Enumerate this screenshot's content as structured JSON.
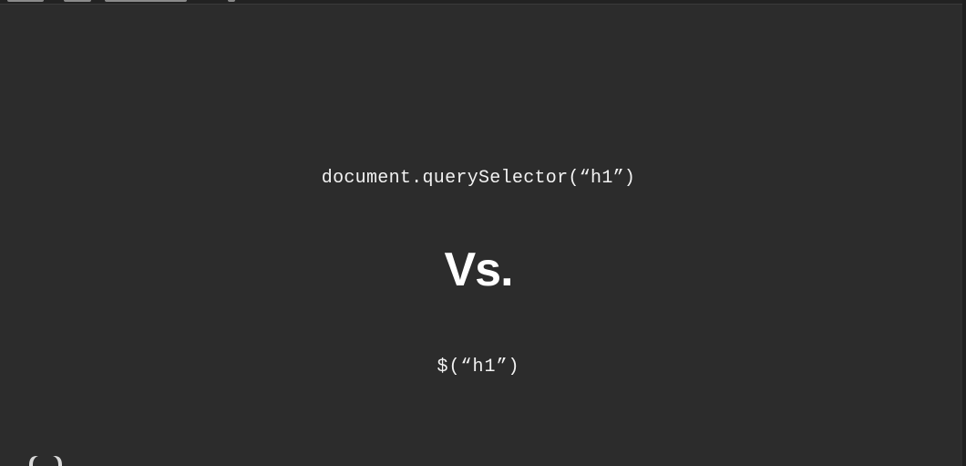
{
  "slide": {
    "code_query_selector": "document.querySelector(“h1”)",
    "versus_label": "Vs.",
    "code_jquery": "$(“h1”)"
  },
  "colors": {
    "background": "#2c2c2c",
    "text": "#f2f2f2"
  },
  "icons": {
    "corner": "brand-logo-icon"
  }
}
